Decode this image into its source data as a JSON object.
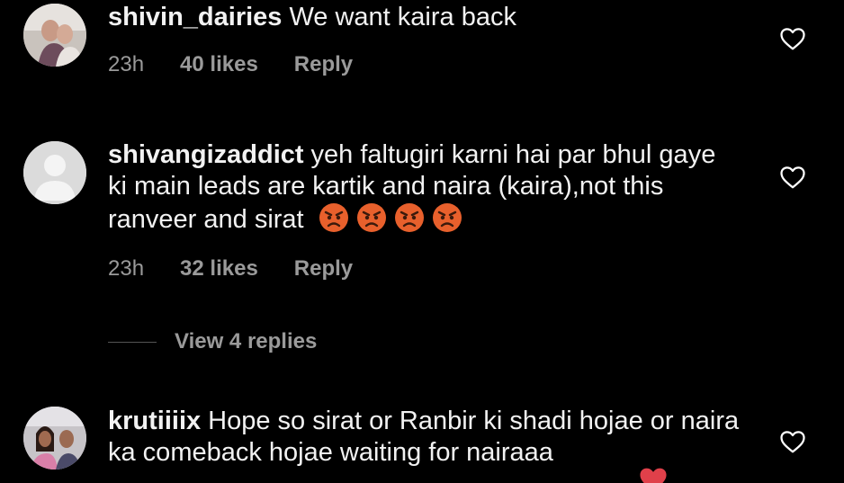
{
  "comments": [
    {
      "username": "shivin_dairies",
      "text": "We want kaira back",
      "time": "23h",
      "likes": "40 likes",
      "reply": "Reply"
    },
    {
      "username": "shivangizaddict",
      "text": "yeh faltugiri karni hai par bhul gaye ki main leads are kartik and naira (kaira),not this ranveer and sirat",
      "time": "23h",
      "likes": "32 likes",
      "reply": "Reply",
      "emojis": [
        "angry-face-icon",
        "angry-face-icon",
        "angry-face-icon",
        "angry-face-icon"
      ]
    },
    {
      "username": "krutiiiix",
      "text": "Hope so sirat or Ranbir ki shadi hojae or naira ka comeback hojae waiting for nairaaa"
    }
  ],
  "view_replies": "View 4 replies",
  "colors": {
    "background": "#000000",
    "text": "#f2f2f2",
    "muted": "#9a9a9a",
    "emoji": "#e8602c"
  }
}
